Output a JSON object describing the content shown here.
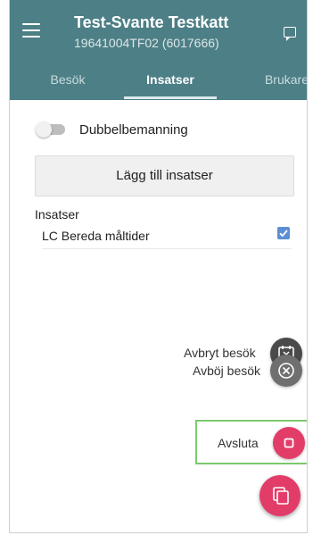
{
  "header": {
    "title": "Test-Svante Testkatt",
    "subtitle": "19641004TF02 (6017666)",
    "menu_icon": "hamburger-menu-icon",
    "chat_icon": "chat-bubble-icon"
  },
  "tabs": [
    {
      "label": "Besök",
      "active": false
    },
    {
      "label": "Insatser",
      "active": true
    },
    {
      "label": "Brukare",
      "active": false
    }
  ],
  "content": {
    "dubbelbemanning": {
      "label": "Dubbelbemanning",
      "on": false
    },
    "add_button_label": "Lägg till insatser",
    "section_title": "Insatser",
    "insatser": [
      {
        "label": "LC Bereda måltider",
        "checked": true
      }
    ]
  },
  "fab_menu": {
    "actions": [
      {
        "label": "Avbryt besök",
        "icon": "calendar-cancel-icon",
        "color": "#4a4a4a"
      },
      {
        "label": "Avböj besök",
        "icon": "circle-x-icon",
        "color": "#6f6f6f"
      },
      {
        "label": "Avsluta",
        "icon": "stop-icon",
        "color": "#e23d69"
      }
    ],
    "main_icon": "copy-icon"
  },
  "colors": {
    "appbar": "#4d7f86",
    "accent": "#e23d69",
    "checkbox": "#5b8fd4",
    "highlight": "#7bc96f"
  }
}
